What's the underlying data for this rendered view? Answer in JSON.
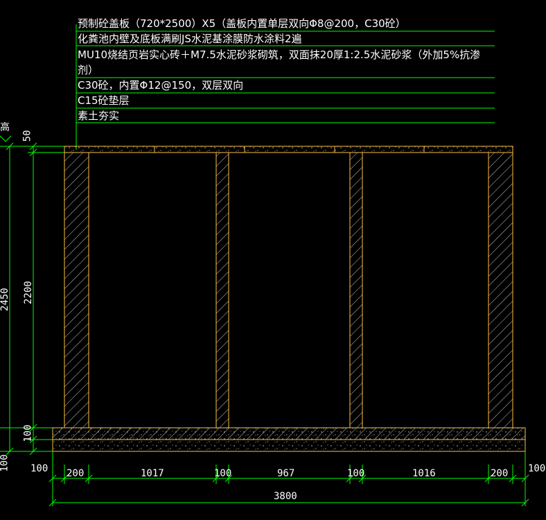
{
  "notes": [
    "预制砼盖板（720*2500）X5（盖板内置单层双向Φ8@200，C30砼）",
    "化粪池内壁及底板满刷JS水泥基涂膜防水涂料2遍",
    "MU10烧结页岩实心砖＋M7.5水泥砂浆砌筑，双面抹20厚1:2.5水泥砂浆（外加5%抗渗",
    "剂）",
    "C30砼，内置Φ12@150，双层双向",
    "C15砼垫层",
    "素土夯实"
  ],
  "left_label": "高",
  "vertical_dims": {
    "total": "2450",
    "inner": "2200",
    "top": "50",
    "slab": "100",
    "base": "100"
  },
  "horizontal_dims": {
    "left_offset": "100",
    "wall_left": "200",
    "bay1": "1017",
    "wall_mid1": "100",
    "bay2": "967",
    "wall_mid2": "100",
    "bay3": "1016",
    "wall_right": "200",
    "right_offset": "100",
    "total": "3800"
  },
  "colors": {
    "background": "#000000",
    "leader": "#00ff00",
    "wall": "#ffc040",
    "hatch": "#c0c0c0",
    "dimension": "#00ff00",
    "text": "#ffffff"
  }
}
